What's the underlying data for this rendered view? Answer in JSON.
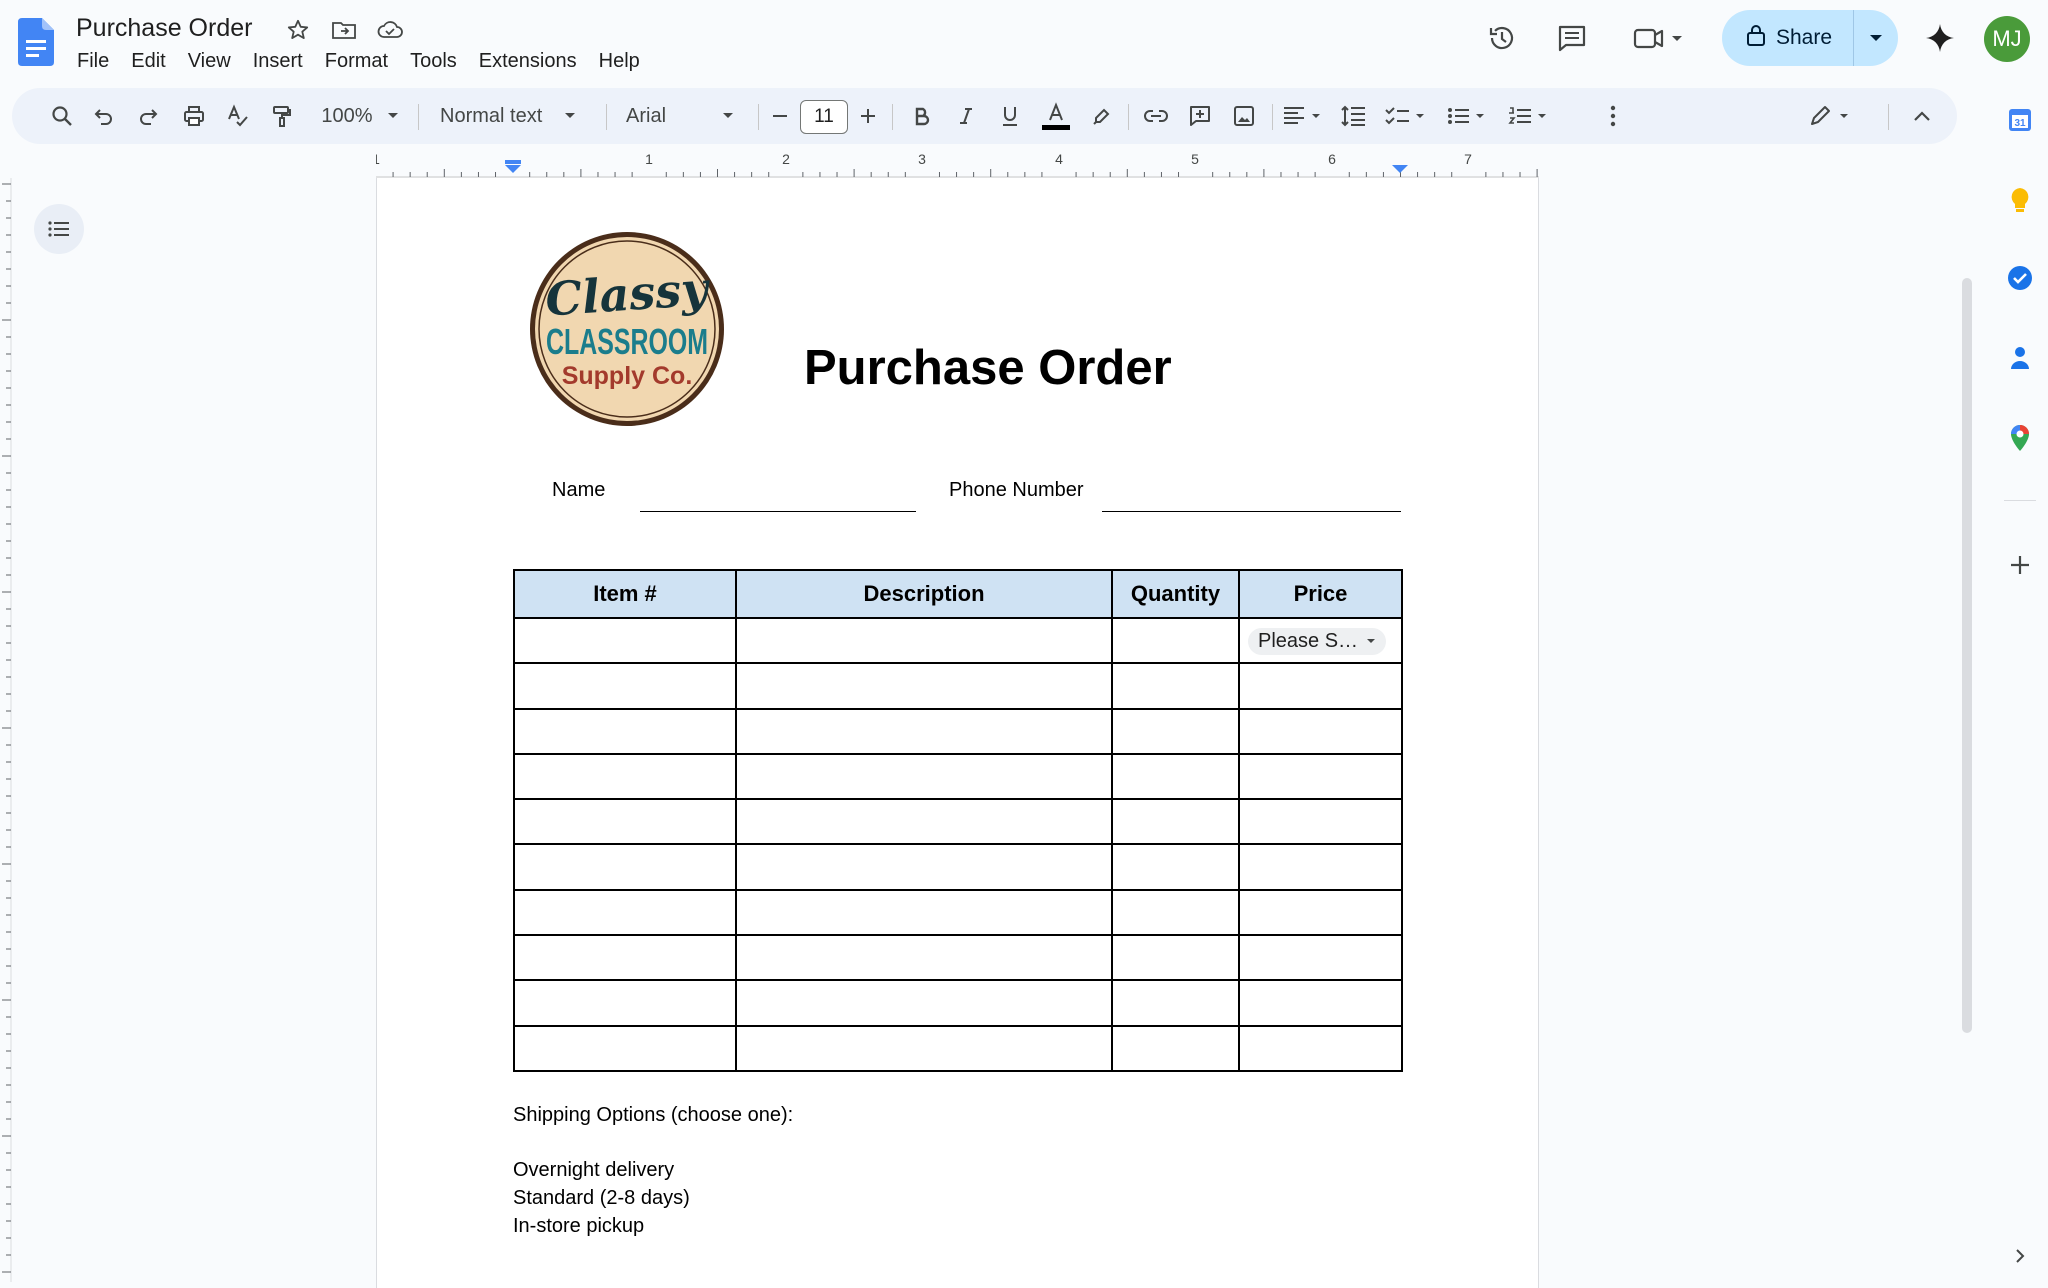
{
  "doc": {
    "title": "Purchase Order",
    "menu": [
      "File",
      "Edit",
      "View",
      "Insert",
      "Format",
      "Tools",
      "Extensions",
      "Help"
    ],
    "share_label": "Share",
    "avatar_initials": "MJ"
  },
  "toolbar": {
    "zoom": "100%",
    "style": "Normal text",
    "font": "Arial",
    "font_size": "11"
  },
  "ruler": {
    "numbers": [
      "1",
      "1",
      "2",
      "3",
      "4",
      "5",
      "6",
      "7"
    ]
  },
  "content": {
    "heading": "Purchase Order",
    "logo": {
      "line1": "Classy",
      "line2": "CLASSROOM",
      "line3": "Supply Co."
    },
    "name_label": "Name",
    "phone_label": "Phone Number",
    "table": {
      "headers": [
        "Item #",
        "Description",
        "Quantity",
        "Price"
      ],
      "row_count": 10,
      "price_dropdown": "Please S…"
    },
    "shipping_title": "Shipping Options (choose one):",
    "shipping_options": [
      "Overnight delivery",
      "Standard (2-8 days)",
      "In-store pickup"
    ]
  },
  "colors": {
    "accent": "#0b57d0",
    "share_bg": "#c2e7ff",
    "header_fill": "#cfe2f3",
    "logo_teal": "#1b7d8c",
    "logo_red": "#a33a2c",
    "logo_ring": "#4a2d1a",
    "logo_fill": "#f1d7b0"
  }
}
